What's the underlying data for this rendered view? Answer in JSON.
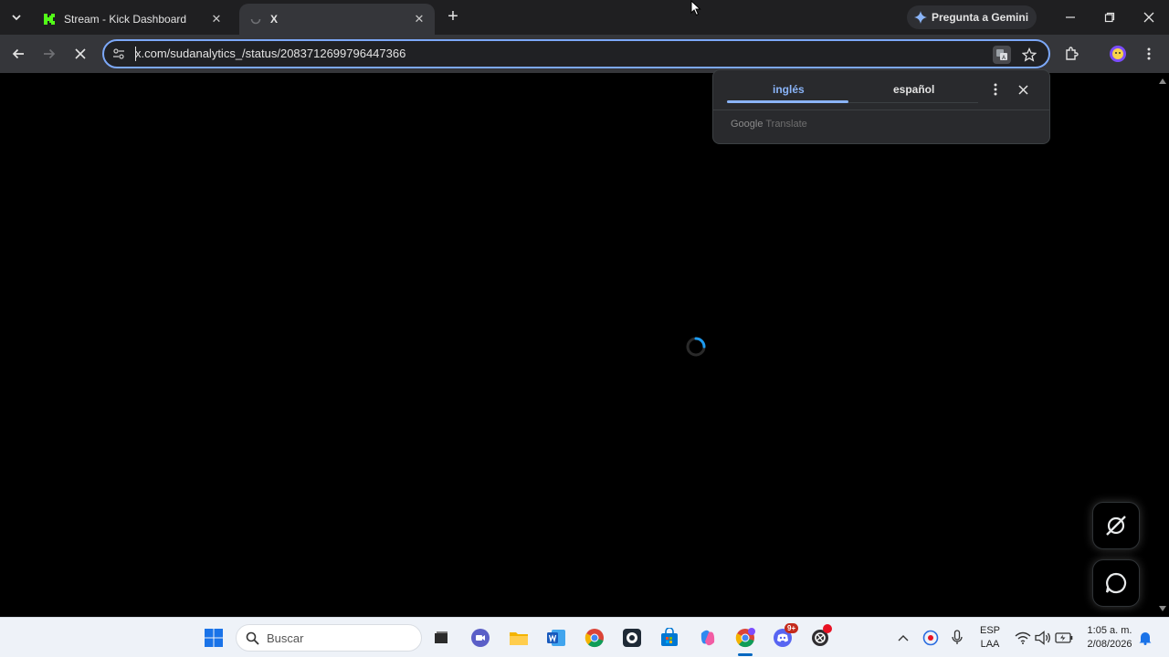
{
  "tabs": [
    {
      "title": "Stream - Kick Dashboard",
      "active": false
    },
    {
      "title": "X",
      "active": true
    }
  ],
  "gemini_button": "Pregunta a Gemini",
  "omnibox": {
    "url": "x.com/sudanalytics_/status/2083712699796447366"
  },
  "translate_bubble": {
    "source_language": "inglés",
    "target_language": "español",
    "brand_google": "Google",
    "brand_translate": "Translate"
  },
  "page": {
    "state": "loading"
  },
  "taskbar": {
    "search_placeholder": "Buscar",
    "language_top": "ESP",
    "language_bottom": "LAA",
    "time": "1:05 a. m.",
    "date": "2/08/2026",
    "discord_badge": "9+"
  },
  "colors": {
    "accent": "#8ab4f8",
    "kick_green": "#53fc18",
    "chrome_dark": "#1f1f21"
  }
}
